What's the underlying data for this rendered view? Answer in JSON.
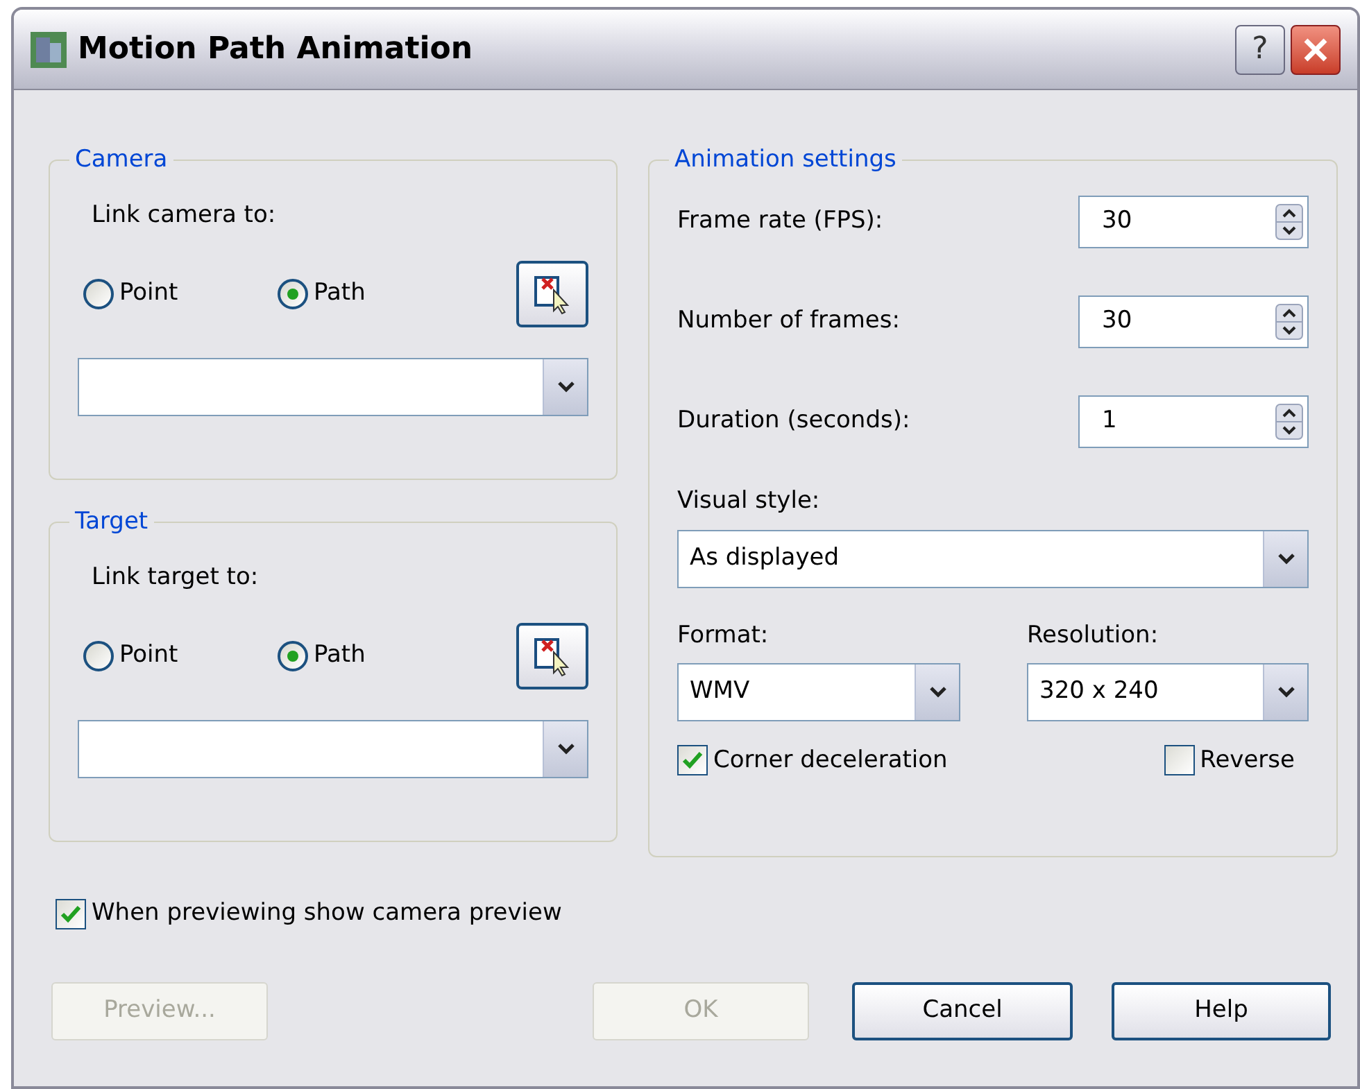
{
  "window": {
    "title": "Motion Path Animation",
    "help_glyph": "?"
  },
  "camera": {
    "title": "Camera",
    "link_label": "Link camera to:",
    "options": [
      {
        "label": "Point",
        "selected": false
      },
      {
        "label": "Path",
        "selected": true
      }
    ]
  },
  "target": {
    "title": "Target",
    "link_label": "Link target to:",
    "options": [
      {
        "label": "Point",
        "selected": false
      },
      {
        "label": "Path",
        "selected": true
      }
    ]
  },
  "animation_settings": {
    "title": "Animation settings",
    "spinners": [
      {
        "label": "Frame rate (FPS):",
        "value": "30"
      },
      {
        "label": "Number of frames:",
        "value": "30"
      },
      {
        "label": "Duration (seconds):",
        "value": "1"
      }
    ],
    "visual_style": {
      "label": "Visual style:",
      "value": "As displayed"
    },
    "format": {
      "label": "Format:",
      "value": "WMV"
    },
    "resolution": {
      "label": "Resolution:",
      "value": "320 x 240"
    },
    "options": [
      {
        "label": "Corner deceleration",
        "checked": true
      },
      {
        "label": "Reverse",
        "checked": false
      }
    ]
  },
  "camera_preview": {
    "label": "When previewing show camera preview",
    "checked": true
  },
  "buttons": [
    {
      "label": "Preview...",
      "disabled": true
    },
    {
      "label": "OK",
      "disabled": true
    },
    {
      "label": "Cancel",
      "disabled": false
    },
    {
      "label": "Help",
      "disabled": false
    }
  ]
}
